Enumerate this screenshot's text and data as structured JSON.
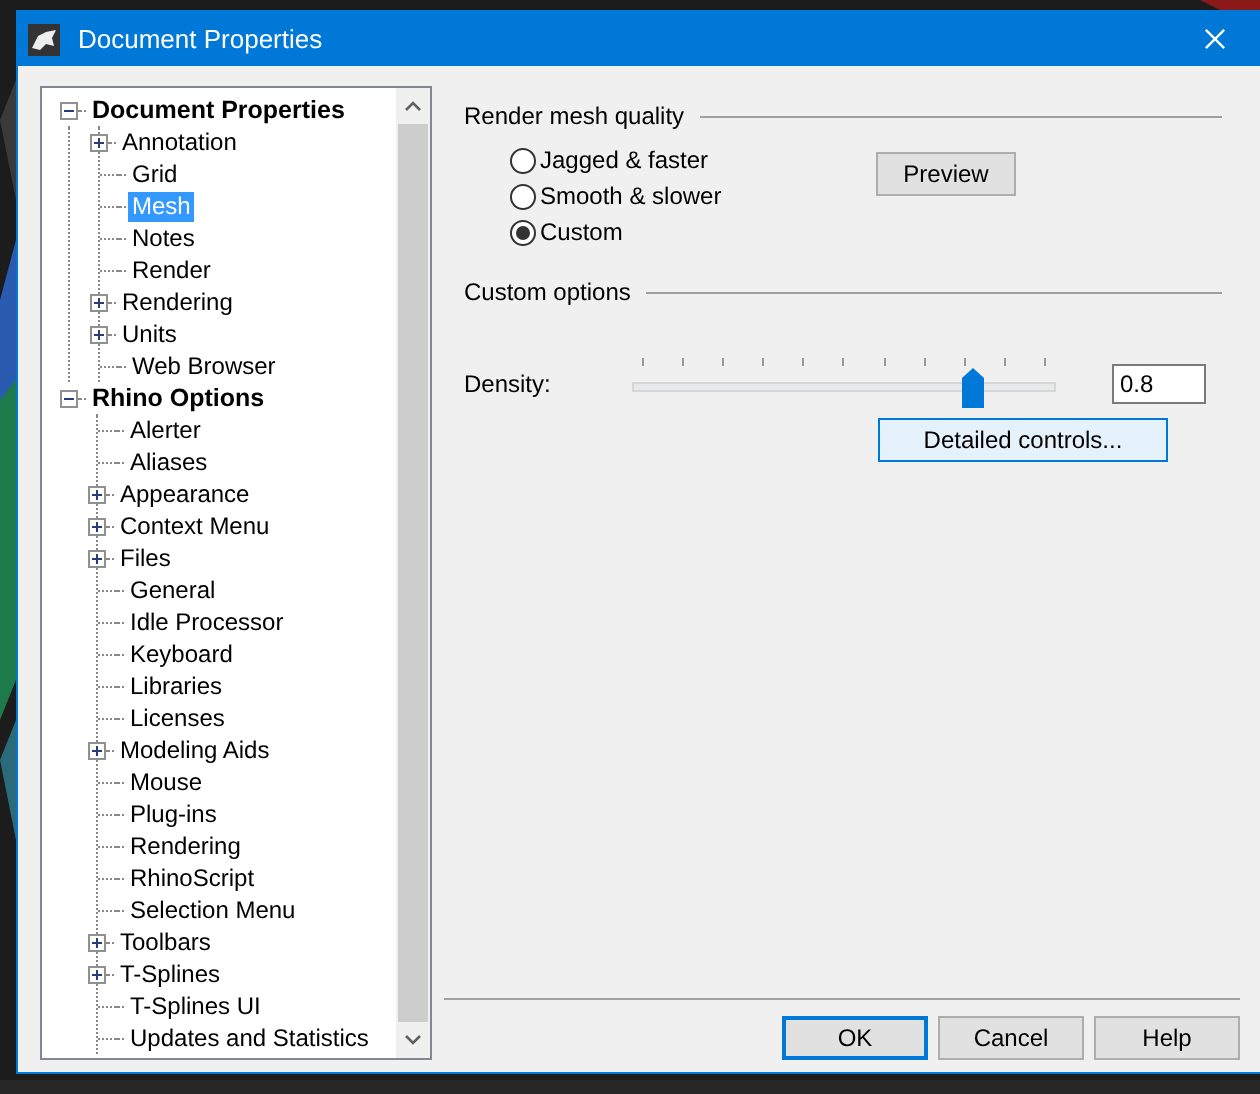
{
  "window": {
    "title": "Document Properties"
  },
  "tree": [
    {
      "label": "Document Properties",
      "expanded": true,
      "selected": false,
      "children": [
        {
          "label": "Annotation",
          "expandable": true,
          "selected": false
        },
        {
          "label": "Grid",
          "expandable": false,
          "selected": false
        },
        {
          "label": "Mesh",
          "expandable": false,
          "selected": true
        },
        {
          "label": "Notes",
          "expandable": false,
          "selected": false
        },
        {
          "label": "Render",
          "expandable": false,
          "selected": false
        },
        {
          "label": "Rendering",
          "expandable": true,
          "selected": false
        },
        {
          "label": "Units",
          "expandable": true,
          "selected": false
        },
        {
          "label": "Web Browser",
          "expandable": false,
          "selected": false
        }
      ]
    },
    {
      "label": "Rhino Options",
      "expanded": true,
      "selected": false,
      "children": [
        {
          "label": "Alerter",
          "expandable": false,
          "selected": false
        },
        {
          "label": "Aliases",
          "expandable": false,
          "selected": false
        },
        {
          "label": "Appearance",
          "expandable": true,
          "selected": false
        },
        {
          "label": "Context Menu",
          "expandable": true,
          "selected": false
        },
        {
          "label": "Files",
          "expandable": true,
          "selected": false
        },
        {
          "label": "General",
          "expandable": false,
          "selected": false
        },
        {
          "label": "Idle Processor",
          "expandable": false,
          "selected": false
        },
        {
          "label": "Keyboard",
          "expandable": false,
          "selected": false
        },
        {
          "label": "Libraries",
          "expandable": false,
          "selected": false
        },
        {
          "label": "Licenses",
          "expandable": false,
          "selected": false
        },
        {
          "label": "Modeling Aids",
          "expandable": true,
          "selected": false
        },
        {
          "label": "Mouse",
          "expandable": false,
          "selected": false
        },
        {
          "label": "Plug-ins",
          "expandable": false,
          "selected": false
        },
        {
          "label": "Rendering",
          "expandable": false,
          "selected": false
        },
        {
          "label": "RhinoScript",
          "expandable": false,
          "selected": false
        },
        {
          "label": "Selection Menu",
          "expandable": false,
          "selected": false
        },
        {
          "label": "Toolbars",
          "expandable": true,
          "selected": false
        },
        {
          "label": "T-Splines",
          "expandable": true,
          "selected": false
        },
        {
          "label": "T-Splines UI",
          "expandable": false,
          "selected": false
        },
        {
          "label": "Updates and Statistics",
          "expandable": false,
          "selected": false
        }
      ]
    }
  ],
  "render_mesh_quality": {
    "heading": "Render mesh quality",
    "options": [
      {
        "label": "Jagged & faster",
        "selected": false
      },
      {
        "label": "Smooth & slower",
        "selected": false
      },
      {
        "label": "Custom",
        "selected": true
      }
    ],
    "preview_button": "Preview"
  },
  "custom_options": {
    "heading": "Custom options",
    "density": {
      "label": "Density:",
      "level": 0.8,
      "value": "0.8"
    },
    "detailed_button": "Detailed controls..."
  },
  "buttons": [
    {
      "label": "OK",
      "default": true
    },
    {
      "label": "Cancel",
      "default": false
    },
    {
      "label": "Help",
      "default": false
    }
  ]
}
